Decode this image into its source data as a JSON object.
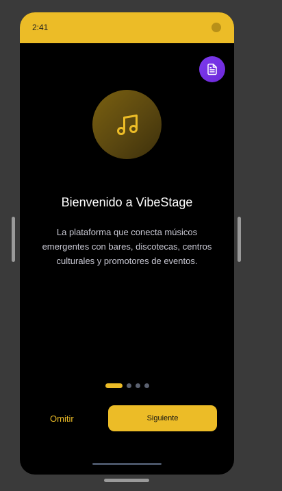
{
  "status_bar": {
    "time": "2:41"
  },
  "onboarding": {
    "title": "Bienvenido a VibeStage",
    "description": "La plataforma que conecta músicos emergentes con bares, discotecas, centros culturales y promotores de eventos.",
    "music_icon": "music-note-icon",
    "doc_icon": "document-icon",
    "page_indicator": {
      "current": 1,
      "total": 4
    }
  },
  "actions": {
    "skip_label": "Omitir",
    "next_label": "Siguiente"
  },
  "colors": {
    "accent": "#ecbc27",
    "purple": "#7c3aed",
    "background": "#000000"
  }
}
